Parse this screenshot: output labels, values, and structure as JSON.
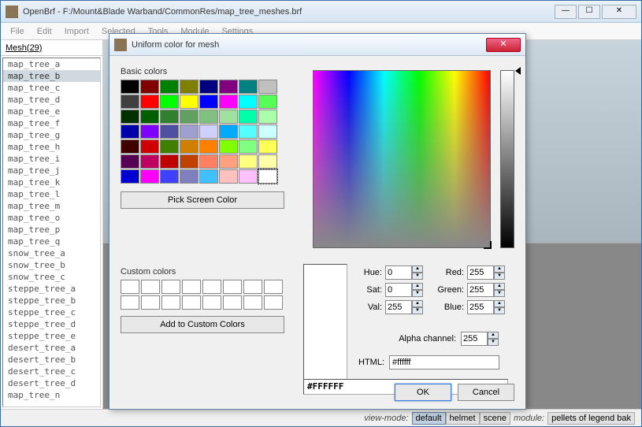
{
  "window": {
    "title": "OpenBrf - F:/Mount&Blade Warband/CommonRes/map_tree_meshes.brf"
  },
  "menu": {
    "items": [
      "File",
      "Edit",
      "Import",
      "Selected",
      "Tools",
      "Module",
      "Settings"
    ]
  },
  "tab": {
    "label": "Mesh",
    "count": "(29)"
  },
  "meshes": [
    "map_tree_a",
    "map_tree_b",
    "map_tree_c",
    "map_tree_d",
    "map_tree_e",
    "map_tree_f",
    "map_tree_g",
    "map_tree_h",
    "map_tree_i",
    "map_tree_j",
    "map_tree_k",
    "map_tree_l",
    "map_tree_m",
    "map_tree_o",
    "map_tree_p",
    "map_tree_q",
    "snow_tree_a",
    "snow_tree_b",
    "snow_tree_c",
    "steppe_tree_a",
    "steppe_tree_b",
    "steppe_tree_c",
    "steppe_tree_d",
    "steppe_tree_e",
    "desert_tree_a",
    "desert_tree_b",
    "desert_tree_c",
    "desert_tree_d",
    "map_tree_n"
  ],
  "selected_mesh": 1,
  "statusbar": {
    "viewmode_label": "view-mode:",
    "modes": [
      "default",
      "helmet",
      "scene"
    ],
    "active_mode": 0,
    "module_label": "module:",
    "module_value": "pellets of legend bak"
  },
  "dialog": {
    "title": "Uniform color for mesh",
    "basic_label": "Basic colors",
    "basic_colors": [
      "#000000",
      "#800000",
      "#008000",
      "#808000",
      "#000080",
      "#800080",
      "#008080",
      "#c0c0c0",
      "#404040",
      "#ff0000",
      "#00ff00",
      "#ffff00",
      "#0000ff",
      "#ff00ff",
      "#00ffff",
      "#55ff55",
      "#003000",
      "#006000",
      "#308030",
      "#60a060",
      "#80c080",
      "#a0e0a0",
      "#00ffaa",
      "#aaffaa",
      "#0000aa",
      "#8000ff",
      "#5050a0",
      "#a0a0d0",
      "#d0d0ff",
      "#00aaff",
      "#55ffff",
      "#ccffff",
      "#400000",
      "#d00000",
      "#408000",
      "#d08000",
      "#ff8000",
      "#80ff00",
      "#80ff80",
      "#ffff55",
      "#550055",
      "#c00060",
      "#c00000",
      "#c04000",
      "#ff8060",
      "#ffa080",
      "#ffff80",
      "#ffffaa",
      "#0000d0",
      "#ff00ff",
      "#4040ff",
      "#8080c0",
      "#40c0ff",
      "#ffc0c0",
      "#ffc0ff",
      "#ffffff"
    ],
    "selected_basic": 55,
    "pick_btn": "Pick Screen Color",
    "custom_label": "Custom colors",
    "custom_count": 16,
    "add_custom_btn": "Add to Custom Colors",
    "fields": {
      "hue_label": "Hue:",
      "hue": "0",
      "sat_label": "Sat:",
      "sat": "0",
      "val_label": "Val:",
      "val": "255",
      "red_label": "Red:",
      "red": "255",
      "green_label": "Green:",
      "green": "255",
      "blue_label": "Blue:",
      "blue": "255",
      "alpha_label": "Alpha channel:",
      "alpha": "255",
      "html_label": "HTML:",
      "html": "#ffffff"
    },
    "hex_display": "#FFFFFF",
    "ok": "OK",
    "cancel": "Cancel"
  }
}
